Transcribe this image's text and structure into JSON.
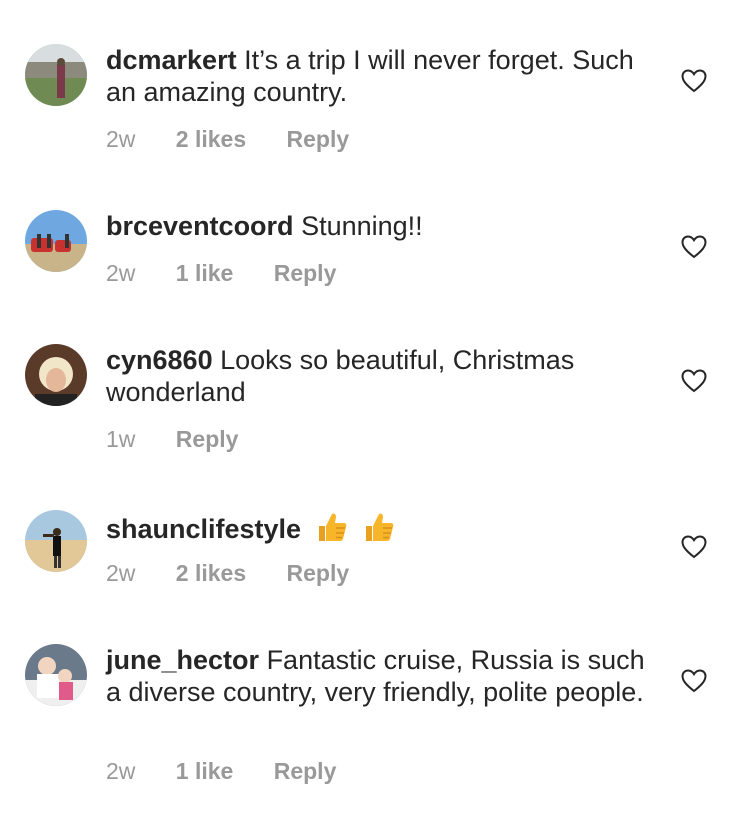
{
  "comments": [
    {
      "username": "dcmarkert",
      "text": "It’s a trip I will never forget. Such an amazing country.",
      "time": "2w",
      "likes": "2 likes",
      "reply": "Reply"
    },
    {
      "username": "brceventcoord",
      "text": "Stunning!!",
      "time": "2w",
      "likes": "1 like",
      "reply": "Reply"
    },
    {
      "username": "cyn6860",
      "text": "Looks so beautiful, Christmas wonderland",
      "time": "1w",
      "reply": "Reply"
    },
    {
      "username": "shaunclifestyle",
      "text": "",
      "emoji": [
        "thumbs-up-icon",
        "thumbs-up-icon"
      ],
      "time": "2w",
      "likes": "2 likes",
      "reply": "Reply"
    },
    {
      "username": "june_hector",
      "text": "Fantastic cruise, Russia is such a diverse country, very friendly, polite people.",
      "time": "2w",
      "likes": "1 like",
      "reply": "Reply"
    }
  ],
  "colors": {
    "text": "#262626",
    "meta": "#999999",
    "heart_stroke": "#262626",
    "thumbs_up": "#f7b529"
  }
}
